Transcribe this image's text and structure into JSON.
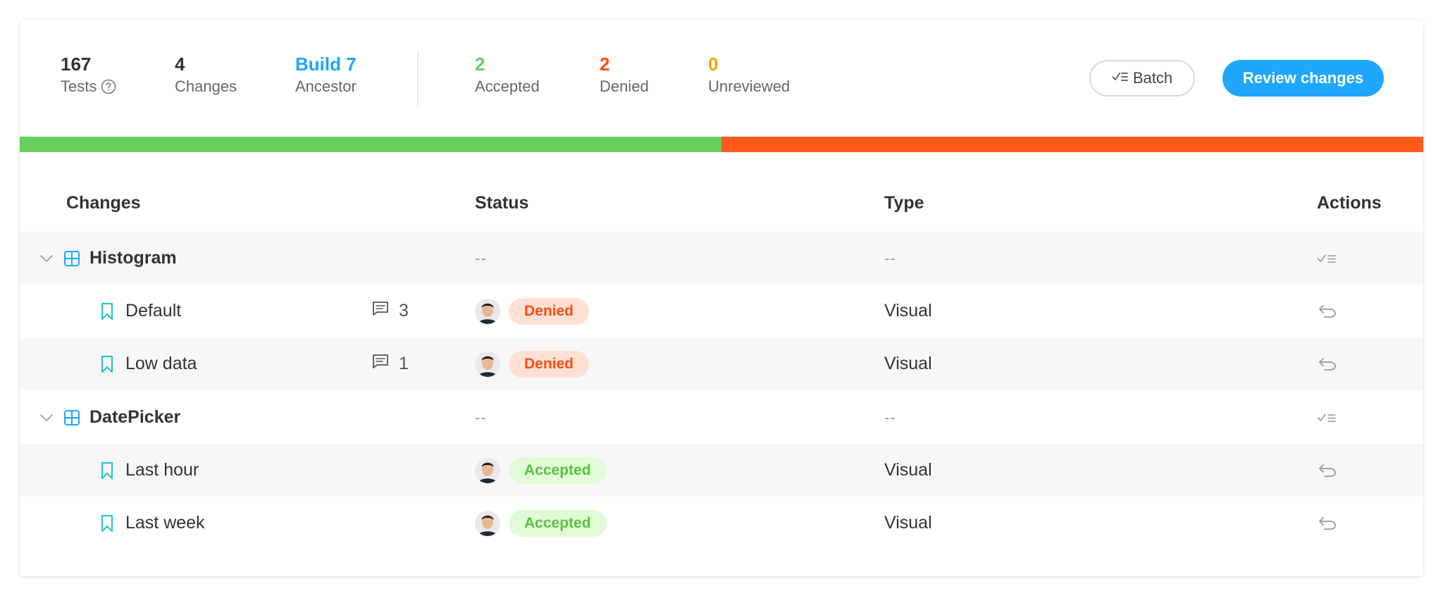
{
  "stats": {
    "tests": {
      "value": "167",
      "label": "Tests"
    },
    "changes": {
      "value": "4",
      "label": "Changes"
    },
    "ancestor": {
      "value": "Build 7",
      "label": "Ancestor"
    },
    "accepted": {
      "value": "2",
      "label": "Accepted"
    },
    "denied": {
      "value": "2",
      "label": "Denied"
    },
    "unreviewed": {
      "value": "0",
      "label": "Unreviewed"
    }
  },
  "buttons": {
    "batch": "Batch",
    "review": "Review changes"
  },
  "progress": {
    "accepted_fraction": 0.5,
    "denied_fraction": 0.5
  },
  "colors": {
    "primary": "#1ea7fd",
    "accepted": "#66cf5e",
    "denied": "#ff5b1a",
    "unreviewed": "#f3a400"
  },
  "table": {
    "headers": {
      "changes": "Changes",
      "status": "Status",
      "type": "Type",
      "actions": "Actions"
    },
    "groups": [
      {
        "name": "Histogram",
        "status": "--",
        "type": "--",
        "rows": [
          {
            "name": "Default",
            "comments": "3",
            "status": "Denied",
            "type": "Visual"
          },
          {
            "name": "Low data",
            "comments": "1",
            "status": "Denied",
            "type": "Visual"
          }
        ]
      },
      {
        "name": "DatePicker",
        "status": "--",
        "type": "--",
        "rows": [
          {
            "name": "Last hour",
            "status": "Accepted",
            "type": "Visual"
          },
          {
            "name": "Last week",
            "status": "Accepted",
            "type": "Visual"
          }
        ]
      }
    ]
  },
  "icons": {
    "help": "help-circle-icon",
    "batch": "checklist-icon",
    "expand": "chevron-down-icon",
    "component": "grid-icon",
    "story": "bookmark-icon",
    "comment": "comment-icon",
    "undo": "undo-icon"
  }
}
